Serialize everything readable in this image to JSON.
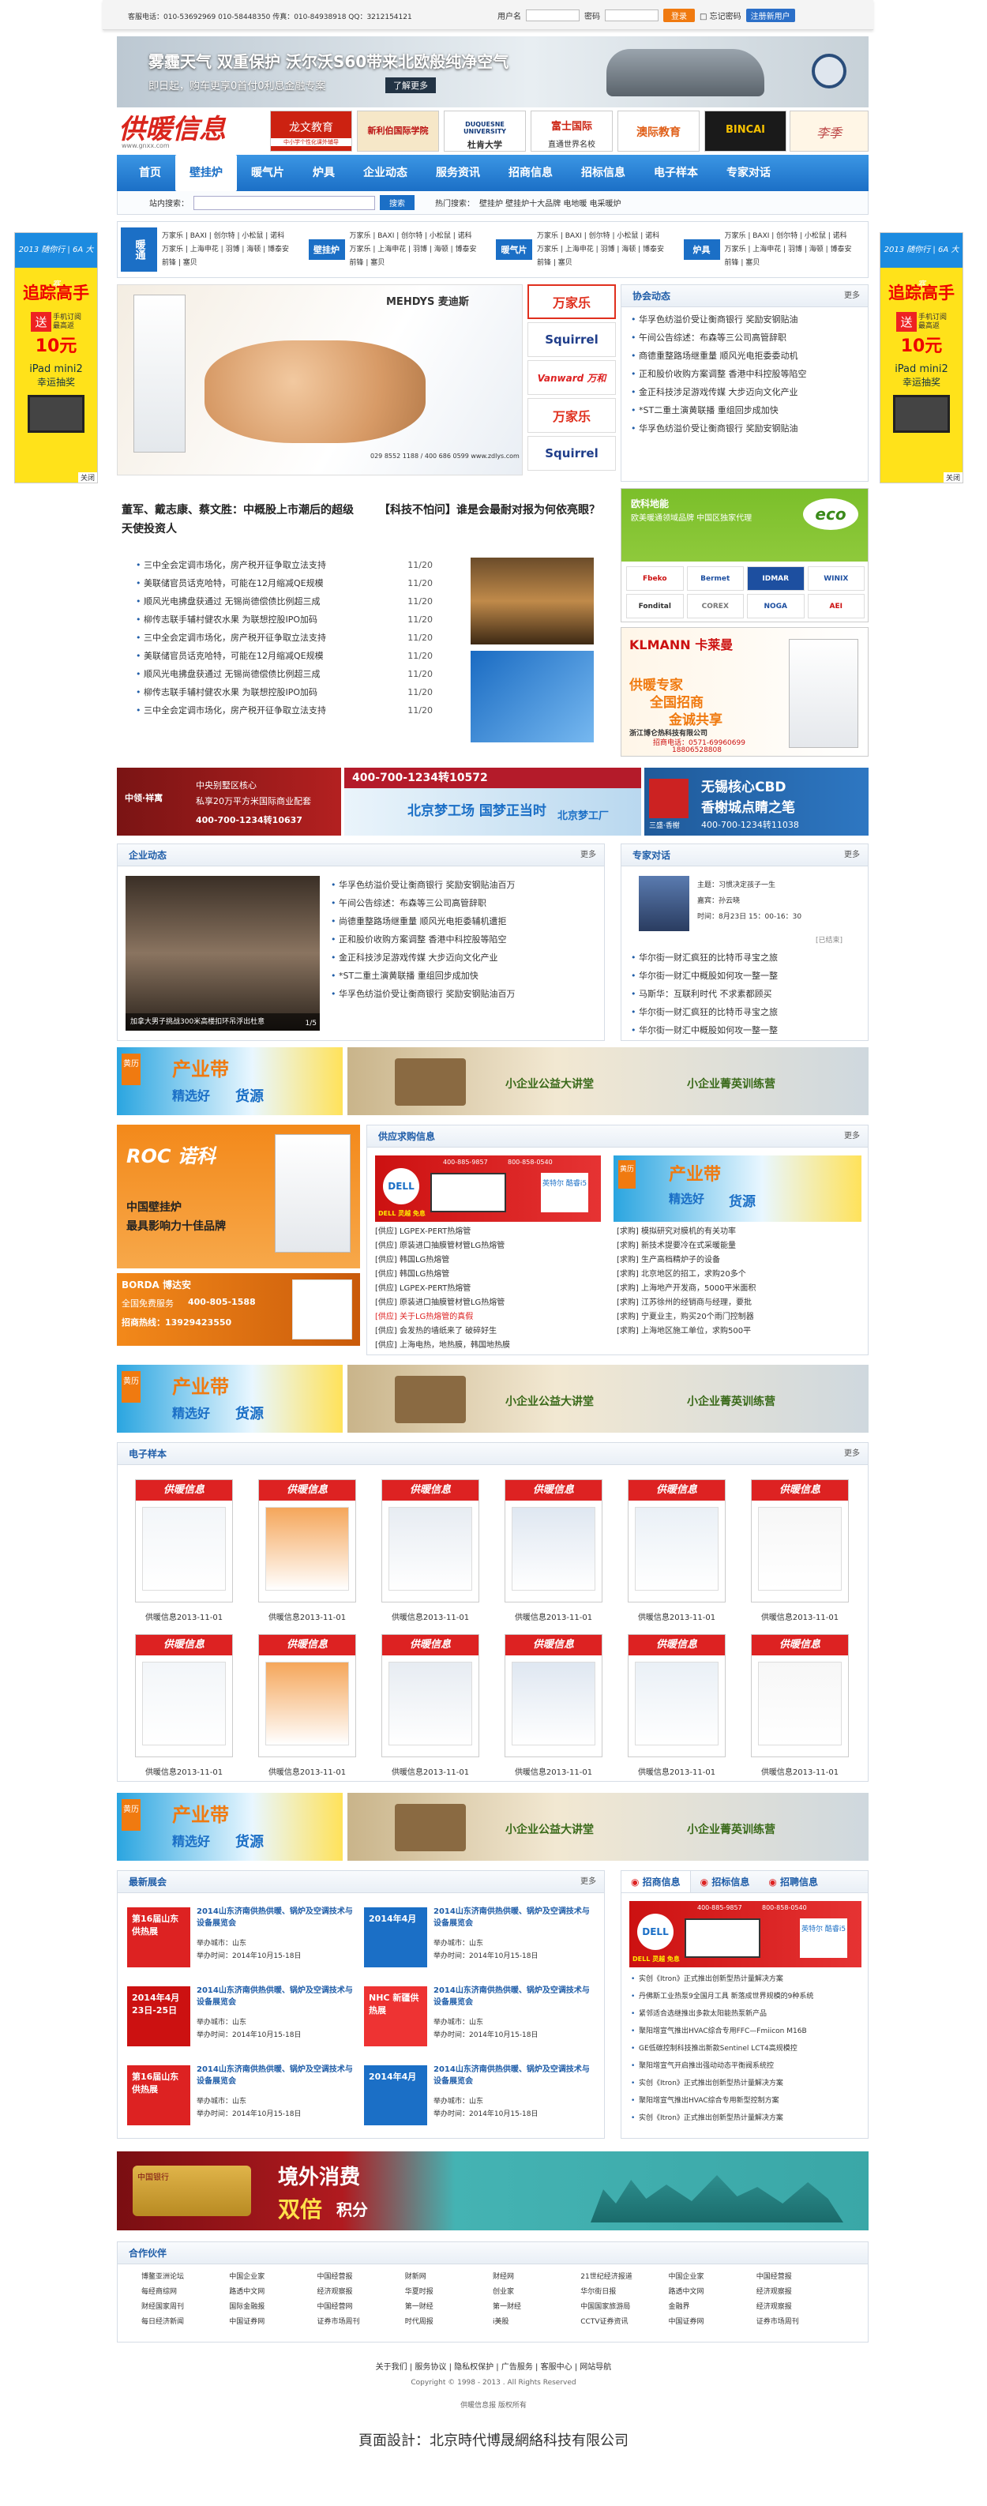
{
  "top": {
    "contact": "客服电话：010-53692969 010-58448350 传真：010-84938918 QQ：3212154121",
    "user_label": "用户名",
    "pwd_label": "密码",
    "login_btn": "登录",
    "forget": "忘记密码",
    "register_btn": "注册新用户"
  },
  "banner_top": {
    "line1": "雾霾天气 双重保护 沃尔沃S60带来北欧般纯净空气",
    "line2": "即日起，购车更享0首付0利息金融专案",
    "btn": "了解更多"
  },
  "logo": {
    "text": "供暖信息",
    "sub": "www.gnxx.com"
  },
  "logo_ads": [
    "龙文教育",
    "中小学个性化课外辅导",
    "新利伯国际学院",
    "DUQUESNE UNIVERSITY",
    "杜肯大学",
    "富士国际",
    "直通世界名校",
    "澳际教育",
    "BINCAI",
    "李季"
  ],
  "nav": [
    "首页",
    "壁挂炉",
    "暖气片",
    "炉具",
    "企业动态",
    "服务资讯",
    "招商信息",
    "招标信息",
    "电子样本",
    "专家对话"
  ],
  "search": {
    "label": "站内搜索：",
    "btn": "搜索",
    "hot_label": "热门搜索：",
    "hot": "壁挂炉  壁挂炉十大品牌  电地暖  电采暖炉"
  },
  "cats": [
    {
      "head": "暖通",
      "rows": [
        "万家乐 | BAXI | 创尔特 | 小松鼠 | 诺科",
        "万家乐 | 上海申花 | 羽博 | 海顿 | 博泰安",
        "前锋 | 塞贝"
      ]
    },
    {
      "head": "壁挂炉",
      "rows": [
        "万家乐 | BAXI | 创尔特 | 小松鼠 | 诺科",
        "万家乐 | 上海申花 | 羽博 | 海顿 | 博泰安",
        "前锋 | 塞贝"
      ]
    },
    {
      "head": "暖气片",
      "rows": [
        "万家乐 | BAXI | 创尔特 | 小松鼠 | 诺科",
        "万家乐 | 上海申花 | 羽博 | 海顿 | 博泰安",
        "前锋 | 塞贝"
      ]
    },
    {
      "head": "炉具",
      "rows": [
        "万家乐 | BAXI | 创尔特 | 小松鼠 | 诺科",
        "万家乐 | 上海申花 | 羽博 | 海顿 | 博泰安",
        "前锋 | 塞贝"
      ]
    }
  ],
  "side_ad": {
    "head": "2013 随你行 | 6A 大赛",
    "big": "追踪高手",
    "send": "送",
    "t1": "手机订阅",
    "t2": "最高返",
    "money": "10元",
    "ipad": "iPad mini2",
    "sub": "幸运抽奖",
    "close": "关闭"
  },
  "focus": {
    "brand": "MEHDYS 麦迪斯",
    "phone": "029 8552 1188 / 400 686 0599   www.zdlys.com"
  },
  "brand_logos": [
    "万家乐",
    "Squirrel",
    "Vanward 万和",
    "万家乐",
    "Squirrel"
  ],
  "assoc": {
    "title": "协会动态",
    "more": "更多",
    "items": [
      "华孚色纺溢价受让衡商银行 奖励安钢贴油",
      "午间公告综述：布森等三公司高管辞职",
      "商德重整路场继重量 顺风光电拒委委动机",
      "正和股价收购方案调整 香港中科控股等陷空",
      "金正科技涉足游戏传媒 大步迈向文化产业",
      "*ST二重土演黄联播 重组回步成加快",
      "华孚色纺溢价受让衡商银行 奖励安钢贴油"
    ]
  },
  "headline": {
    "h1": "董军、戴志康、蔡文胜：中概股上市潮后的超级天使投资人",
    "h2": "【科技不怕问】谁是会最耐对报为何依亮眼？",
    "items": [
      {
        "t": "三中全会定调市场化，房产税开征争取立法支持",
        "d": "11/20"
      },
      {
        "t": "美联储官员话克哈特，可能在12月缩减QE规模",
        "d": "11/20"
      },
      {
        "t": "顺风光电拂盘获通过 无锡尚德偿债比例超三成",
        "d": "11/20"
      },
      {
        "t": "柳传志联手辅村健农水果 为联想控股IPO加码",
        "d": "11/20"
      },
      {
        "t": "三中全会定调市场化，房产税开征争取立法支持",
        "d": "11/20"
      },
      {
        "t": "美联储官员话克哈特，可能在12月缩减QE规模",
        "d": "11/20"
      },
      {
        "t": "顺风光电拂盘获通过 无锡尚德偿债比例超三成",
        "d": "11/20"
      },
      {
        "t": "柳传志联手辅村健农水果 为联想控股IPO加码",
        "d": "11/20"
      },
      {
        "t": "三中全会定调市场化，房产税开征争取立法支持",
        "d": "11/20"
      }
    ]
  },
  "ad_europe": {
    "t1": "欧科地能",
    "t2": "欧美暖通领域品牌 中国区独家代理",
    "logo": "eco",
    "brands": [
      "Fbeko",
      "Bermet",
      "IDMAR",
      "WINIX",
      "Fondital",
      "COREX",
      "NOGA",
      "AEI"
    ]
  },
  "ad_klmann": {
    "brand": "KLMANN 卡莱曼",
    "t1": "供暖专家",
    "t2": "全国招商",
    "t3": "金诚共享",
    "co": "浙江博仑热科技有限公司",
    "tel": "招商电话：0571-69960699",
    "tel2": "18806528808"
  },
  "strip1": [
    {
      "t1": "中央别墅区核心",
      "t2": "私享20万平方米国际商业配套",
      "tel": "400-700-1234转10637",
      "brand": "中领·祥寓"
    },
    {
      "t1": "400-700-1234转10572",
      "t2": "北京梦工场 国梦正当时",
      "brand": "北京梦工厂"
    },
    {
      "t1": "无锡核心CBD",
      "t2": "香榭城点睛之笔",
      "tel": "400-700-1234转11038",
      "brand": "三盛·香榭"
    }
  ],
  "corp": {
    "title": "企业动态",
    "more": "更多",
    "caption": "加拿大男子挑战300米高楼扣环吊浮出杜意",
    "pager": "1/5",
    "items": [
      "华孚色纺溢价受让衡商银行 奖励安钢贴油百万",
      "午间公告综述：布森等三公司高管辞职",
      "尚德重整路场继重量 顺风光电拒委辅机遭拒",
      "正和股价收购方案调整 香港中科控股等陷空",
      "金正科技涉足游戏传媒 大步迈向文化产业",
      "*ST二重土演黄联播 重组回步成加快",
      "华孚色纺溢价受让衡商银行 奖励安钢贴油百万"
    ]
  },
  "expert": {
    "title": "专家对话",
    "more": "更多",
    "topic": "主题：习惯决定孩子一生",
    "guest": "嘉宾：孙云晓",
    "time": "时间：8月23日 15：00-16：30",
    "status": "[已结束]",
    "items": [
      "华尔街一财汇疯狂的比特币寻宝之旅",
      "华尔街一财汇中概股如何攻一整一整",
      "马斯华：互联利时代 不求素都顾买",
      "华尔街一财汇疯狂的比特币寻宝之旅",
      "华尔街一财汇中概股如何攻一整一整"
    ]
  },
  "ad_chan": {
    "tag": "黄历",
    "t1": "产业带",
    "t2": "精选好",
    "t3": "货源"
  },
  "ad_public": {
    "t1": "小企业公益大讲堂",
    "t2": "小企业菁英训练营"
  },
  "ad_roc": {
    "brand": "ROC 诺科",
    "t1": "中国壁挂炉",
    "t2": "最具影响力十佳品牌"
  },
  "ad_borda": {
    "brand": "BORDA 博达安",
    "t1": "全国免费服务",
    "tel": "400-805-1588",
    "t2": "招商热线：13929423550"
  },
  "supply": {
    "title": "供应求购信息",
    "more": "更多",
    "dell": {
      "tel": "400-885-9857",
      "tel2": "800-858-0540",
      "price": "DELL 灵越 免息",
      "note": "英特尔 酷睿i5"
    },
    "left": [
      "[供应] LGPEX-PERT热熔管",
      "[供应] 原装进口抽膜管材管LG热熔管",
      "[供应] 韩国LG热熔管",
      "[供应] 韩国LG热熔管",
      "[供应] LGPEX-PERT热熔管",
      "[供应] 原装进口抽膜管材管LG热熔管",
      "[供应] 关于LG热熔管的真假",
      "[供应] 会发热的墙纸来了 破碎好生",
      "[供应] 上海电热，地热膜，韩国地热膜"
    ],
    "right": [
      "[求购] 模拟研究对膜机的有关功率",
      "[求购] 新技术提要冷在式采暖能量",
      "[求购] 生产高档精炉子的设备",
      "[求购] 北京地区的招工，求购20多个",
      "[求购] 上海地产开发商，5000平米面积",
      "[求购] 江苏徐州的经销商与经理，要批",
      "[求购] 宁夏业主，购买20个雨门控制器",
      "[求购] 上海地区施工单位，求购500平"
    ]
  },
  "esample": {
    "title": "电子样本",
    "more": "更多",
    "label": "供暖信息2013-11-01"
  },
  "expo": {
    "title": "最新展会",
    "more": "更多",
    "items": [
      {
        "img": "第16届山东供热展",
        "t": "2014山东济南供热供暖、锅炉及空调技术与设备展览会",
        "city": "举办城市：山东",
        "date": "举办时间：2014年10月15-18日"
      },
      {
        "img": "2014年4月",
        "t": "2014山东济南供热供暖、锅炉及空调技术与设备展览会",
        "city": "举办城市：山东",
        "date": "举办时间：2014年10月15-18日"
      },
      {
        "img": "2014年4月23日-25日",
        "t": "2014山东济南供热供暖、锅炉及空调技术与设备展览会",
        "city": "举办城市：山东",
        "date": "举办时间：2014年10月15-18日"
      },
      {
        "img": "NHC 新疆供热展",
        "t": "2014山东济南供热供暖、锅炉及空调技术与设备展览会",
        "city": "举办城市：山东",
        "date": "举办时间：2014年10月15-18日"
      },
      {
        "img": "第16届山东供热展",
        "t": "2014山东济南供热供暖、锅炉及空调技术与设备展览会",
        "city": "举办城市：山东",
        "date": "举办时间：2014年10月15-18日"
      },
      {
        "img": "2014年4月",
        "t": "2014山东济南供热供暖、锅炉及空调技术与设备展览会",
        "city": "举办城市：山东",
        "date": "举办时间：2014年10月15-18日"
      }
    ]
  },
  "tabs": {
    "t1": "招商信息",
    "t2": "招标信息",
    "t3": "招聘信息"
  },
  "bidlist": [
    "实创《Itron》正式推出创新型热计量解决方案",
    "丹佛斯工业热泵9全国月工具 新落成世界规模的9种系统",
    "紧邻适合选继推出多款太阳能热泵新产品",
    "聚阳增宣气推出HVAC综合专用FFC—Fmiicon M16B",
    "GE低碳控制科技推出新款Sentinel LCT4高规模控",
    "聚阳增宣气开启推出强动动态平衡阀系统控",
    "实创《Itron》正式推出创新型热计量解决方案",
    "聚阳增宣气推出HVAC综合专用新型控制方案",
    "实创《Itron》正式推出创新型热计量解决方案"
  ],
  "visa": {
    "t1": "境外消费",
    "t2": "双倍",
    "t3": "积分",
    "bank": "中国银行"
  },
  "partners": {
    "title": "合作伙伴",
    "items": [
      "博鳌亚洲论坛",
      "中国企业家",
      "中国经营报",
      "财新网",
      "财经网",
      "21世纪经济报道",
      "中国企业家",
      "中国经营报",
      "每经商综网",
      "路透中文网",
      "经济观察报",
      "华夏时报",
      "创业家",
      "华尔街日报",
      "路透中文网",
      "经济观察报",
      "财经国家周刊",
      "国际金融报",
      "中国经营网",
      "第一财经",
      "第一财经",
      "中国国家旅游局",
      "金融界",
      "经济观察报",
      "每日经济新闻",
      "中国证券网",
      "证券市场周刊",
      "时代周报",
      "i美股",
      "CCTV证券资讯",
      "中国证券网",
      "证券市场周刊"
    ]
  },
  "footer": {
    "links": "关于我们 | 服务协议 | 隐私权保护 | 广告服务 | 客服中心 | 网站导航",
    "copy": "Copyright © 1998 - 2013 . All Rights Reserved",
    "company": "供暖信息报 版权所有",
    "design": "頁面設計：北京時代博晟網絡科技有限公司"
  },
  "colors": {
    "blue": "#1b6fc6",
    "red": "#d9251c",
    "orange": "#f07a10",
    "green": "#7bbf2a"
  }
}
